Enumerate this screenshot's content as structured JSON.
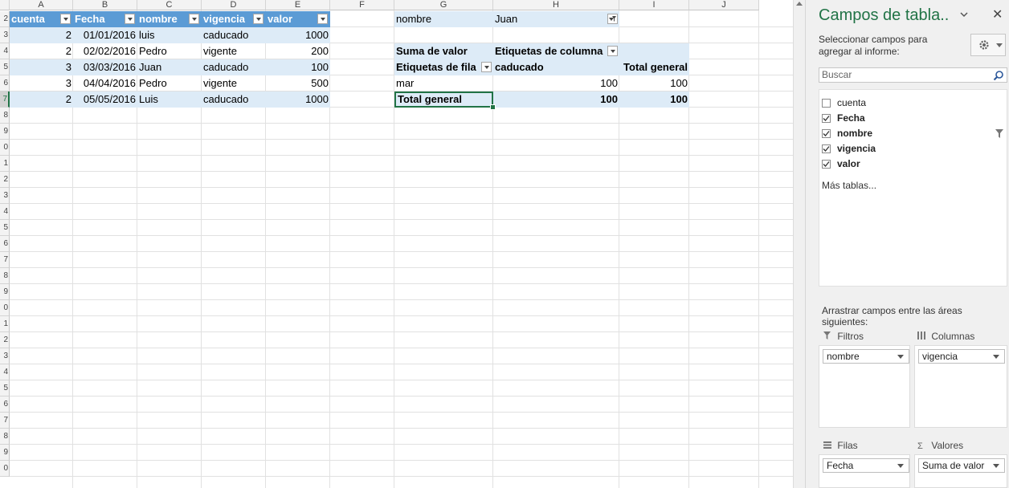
{
  "columns": [
    "A",
    "B",
    "C",
    "D",
    "E",
    "F",
    "G",
    "H",
    "I",
    "J"
  ],
  "rows": [
    "2",
    "3",
    "4",
    "5",
    "6",
    "7",
    "8",
    "9",
    "0",
    "1",
    "2",
    "3",
    "4",
    "5",
    "6",
    "7",
    "8",
    "9",
    "0",
    "1",
    "2",
    "3",
    "4",
    "5",
    "6",
    "7",
    "8",
    "9",
    "0"
  ],
  "table": {
    "headers": [
      "cuenta",
      "Fecha",
      "nombre",
      "vigencia",
      "valor"
    ],
    "rows": [
      [
        "2",
        "01/01/2016",
        "luis",
        "caducado",
        "1000"
      ],
      [
        "2",
        "02/02/2016",
        "Pedro",
        "vigente",
        "200"
      ],
      [
        "3",
        "03/03/2016",
        "Juan",
        "caducado",
        "100"
      ],
      [
        "3",
        "04/04/2016",
        "Pedro",
        "vigente",
        "500"
      ],
      [
        "2",
        "05/05/2016",
        "Luis",
        "caducado",
        "1000"
      ]
    ]
  },
  "pivot": {
    "filter_field": "nombre",
    "filter_value": "Juan",
    "values_label": "Suma de valor",
    "col_labels": "Etiquetas de columna",
    "row_labels": "Etiquetas de fila",
    "col_item": "caducado",
    "grand_total": "Total general",
    "row_item": "mar",
    "row_value": "100",
    "row_total": "100",
    "total_value": "100",
    "total_total": "100"
  },
  "pane": {
    "title": "Campos de tabla..",
    "description": "Seleccionar campos para agregar al informe:",
    "search_placeholder": "Buscar",
    "fields": [
      {
        "name": "cuenta",
        "checked": false
      },
      {
        "name": "Fecha",
        "checked": true
      },
      {
        "name": "nombre",
        "checked": true
      },
      {
        "name": "vigencia",
        "checked": true
      },
      {
        "name": "valor",
        "checked": true
      }
    ],
    "more_tables": "Más tablas...",
    "drag_hint": "Arrastrar campos entre las áreas siguientes:",
    "areas": {
      "filters": {
        "label": "Filtros",
        "item": "nombre"
      },
      "columns": {
        "label": "Columnas",
        "item": "vigencia"
      },
      "rows": {
        "label": "Filas",
        "item": "Fecha"
      },
      "values": {
        "label": "Valores",
        "item": "Suma de valor"
      }
    }
  },
  "colors": {
    "table_header": "#5b9bd5",
    "band": "#ddebf7",
    "accent": "#217346",
    "selection": "#217346"
  }
}
